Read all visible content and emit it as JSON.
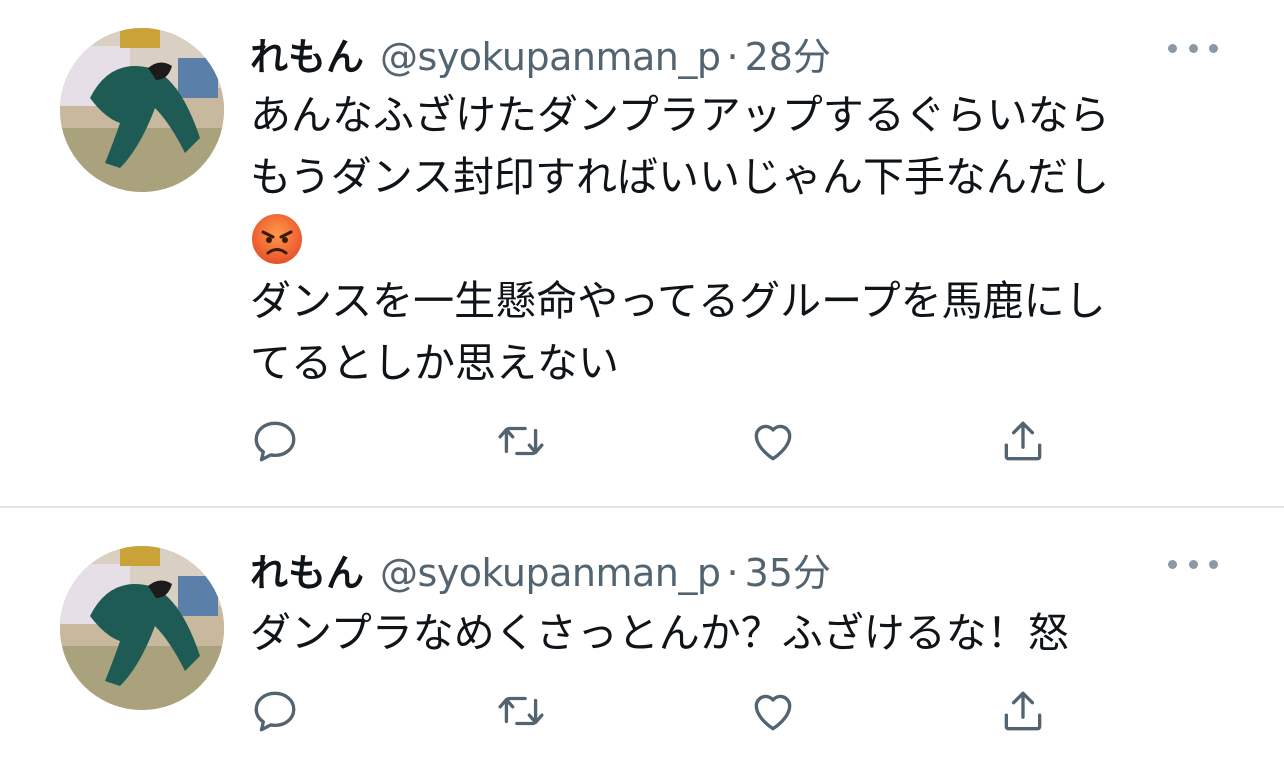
{
  "tweets": [
    {
      "display_name": "れもん",
      "handle": "@syokupanman_p",
      "separator": "·",
      "time": "28分",
      "lines": [
        "あんなふざけたダンプラアップするぐらいなら",
        "もうダンス封印すればいいじゃん下手なんだし"
      ],
      "emoji": "angry-face",
      "lines_after_emoji": [
        "ダンスを一生懸命やってるグループを馬鹿にし",
        "てるとしか思えない"
      ],
      "icons": {
        "reply": "reply-icon",
        "retweet": "retweet-icon",
        "like": "heart-icon",
        "share": "share-icon",
        "more": "more-icon"
      }
    },
    {
      "display_name": "れもん",
      "handle": "@syokupanman_p",
      "separator": "·",
      "time": "35分",
      "lines": [
        "ダンプラなめくさっとんか？ふざけるな！怒"
      ],
      "icons": {
        "reply": "reply-icon",
        "retweet": "retweet-icon",
        "like": "heart-icon",
        "share": "share-icon",
        "more": "more-icon"
      }
    }
  ],
  "colors": {
    "text": "#0f1419",
    "secondary": "#536471",
    "icon": "#536471",
    "divider": "#e3e6e9",
    "emoji": "#e8502a"
  }
}
